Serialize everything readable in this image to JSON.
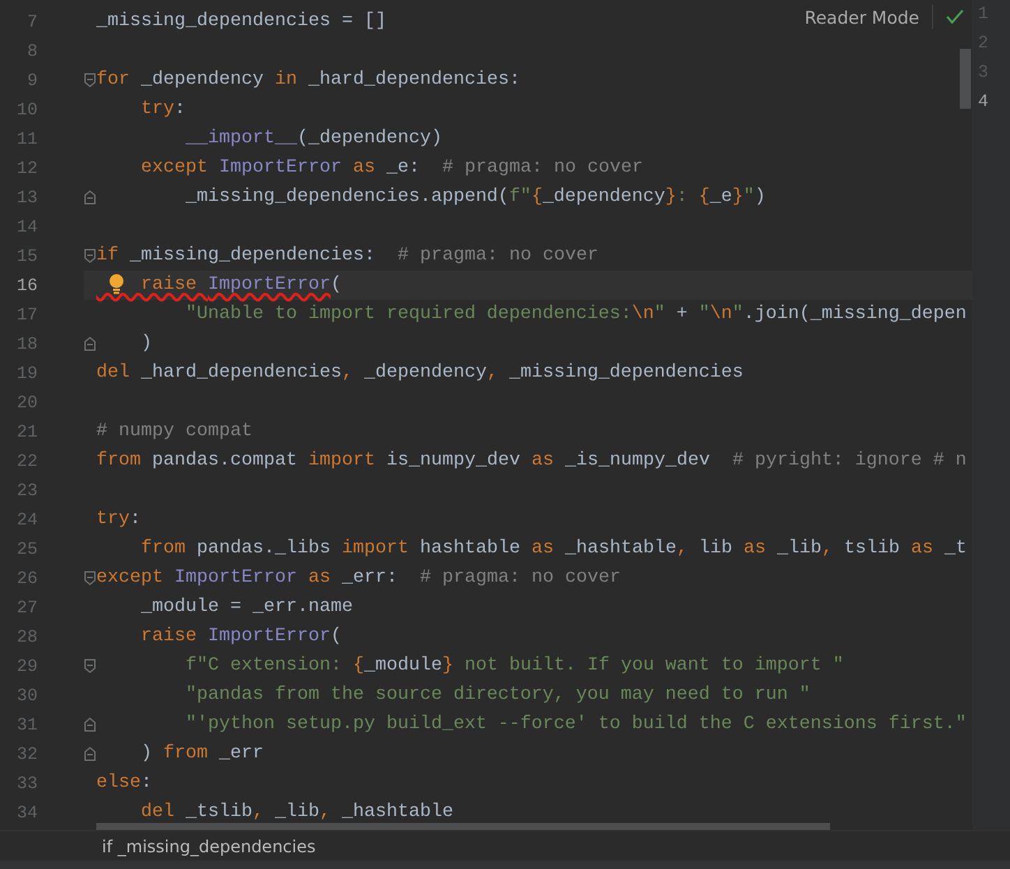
{
  "reader_mode": {
    "label": "Reader Mode"
  },
  "lines": [
    {
      "number": "7",
      "current": false,
      "bulb": false,
      "tokens": [
        {
          "kind": "plain",
          "text": "_missing_dependencies = []"
        }
      ]
    },
    {
      "number": "8",
      "current": false,
      "bulb": false
    },
    {
      "number": "9",
      "current": false,
      "bulb": false,
      "fold": {
        "kind": "start"
      },
      "tokens": [
        {
          "kind": "keyword",
          "text": "for"
        },
        {
          "kind": "plain",
          "text": " _dependency "
        },
        {
          "kind": "keyword",
          "text": "in"
        },
        {
          "kind": "plain",
          "text": " _hard_dependencies:"
        }
      ]
    },
    {
      "number": "10",
      "current": false,
      "bulb": false,
      "tokens": [
        {
          "kind": "keyword",
          "text": "    try"
        },
        {
          "kind": "plain",
          "text": ":"
        }
      ]
    },
    {
      "number": "11",
      "current": false,
      "bulb": false,
      "tokens": [
        {
          "kind": "builtin",
          "text": "        __import__"
        },
        {
          "kind": "plain",
          "text": "(_dependency)"
        }
      ]
    },
    {
      "number": "12",
      "current": false,
      "bulb": false,
      "tokens": [
        {
          "kind": "keyword",
          "text": "    except "
        },
        {
          "kind": "builtin",
          "text": "ImportError "
        },
        {
          "kind": "keyword",
          "text": "as"
        },
        {
          "kind": "plain",
          "text": " _e:  "
        },
        {
          "kind": "comment",
          "text": "# pragma: no cover"
        }
      ]
    },
    {
      "number": "13",
      "current": false,
      "bulb": false,
      "fold": {
        "kind": "end"
      },
      "tokens": [
        {
          "kind": "plain",
          "text": "        _missing_dependencies.append("
        },
        {
          "kind": "string",
          "text": "f\""
        },
        {
          "kind": "punct",
          "text": "{"
        },
        {
          "kind": "plain",
          "text": "_dependency"
        },
        {
          "kind": "punct",
          "text": "}"
        },
        {
          "kind": "string",
          "text": ": "
        },
        {
          "kind": "punct",
          "text": "{"
        },
        {
          "kind": "plain",
          "text": "_e"
        },
        {
          "kind": "punct",
          "text": "}"
        },
        {
          "kind": "string",
          "text": "\""
        },
        {
          "kind": "plain",
          "text": ")"
        }
      ]
    },
    {
      "number": "14",
      "current": false,
      "bulb": false
    },
    {
      "number": "15",
      "current": false,
      "bulb": false,
      "fold": {
        "kind": "start"
      },
      "tokens": [
        {
          "kind": "keyword",
          "text": "if"
        },
        {
          "kind": "plain",
          "text": " _missing_dependencies:  "
        },
        {
          "kind": "comment",
          "text": "# pragma: no cover"
        }
      ]
    },
    {
      "number": "16",
      "current": true,
      "bulb": true,
      "tokens": [
        {
          "kind": "keyword",
          "text": "    raise ",
          "error": true
        },
        {
          "kind": "builtin",
          "text": "ImportError",
          "error": true
        },
        {
          "kind": "plain",
          "text": "("
        }
      ]
    },
    {
      "number": "17",
      "current": false,
      "bulb": false,
      "tokens": [
        {
          "kind": "string",
          "text": "        \"Unable to import required dependencies:"
        },
        {
          "kind": "escape",
          "text": "\\n"
        },
        {
          "kind": "string",
          "text": "\""
        },
        {
          "kind": "plain",
          "text": " + "
        },
        {
          "kind": "string",
          "text": "\""
        },
        {
          "kind": "escape",
          "text": "\\n"
        },
        {
          "kind": "string",
          "text": "\""
        },
        {
          "kind": "plain",
          "text": ".join(_missing_depen"
        }
      ]
    },
    {
      "number": "18",
      "current": false,
      "bulb": false,
      "fold": {
        "kind": "end"
      },
      "tokens": [
        {
          "kind": "plain",
          "text": "    )"
        }
      ]
    },
    {
      "number": "19",
      "current": false,
      "bulb": false,
      "tokens": [
        {
          "kind": "keyword",
          "text": "del"
        },
        {
          "kind": "plain",
          "text": " _hard_dependencies"
        },
        {
          "kind": "punct",
          "text": ", "
        },
        {
          "kind": "plain",
          "text": "_dependency"
        },
        {
          "kind": "punct",
          "text": ", "
        },
        {
          "kind": "plain",
          "text": "_missing_dependencies"
        }
      ]
    },
    {
      "number": "20",
      "current": false,
      "bulb": false
    },
    {
      "number": "21",
      "current": false,
      "bulb": false,
      "tokens": [
        {
          "kind": "comment",
          "text": "# numpy compat"
        }
      ]
    },
    {
      "number": "22",
      "current": false,
      "bulb": false,
      "tokens": [
        {
          "kind": "keyword",
          "text": "from"
        },
        {
          "kind": "plain",
          "text": " pandas.compat "
        },
        {
          "kind": "keyword",
          "text": "import"
        },
        {
          "kind": "plain",
          "text": " is_numpy_dev "
        },
        {
          "kind": "keyword",
          "text": "as"
        },
        {
          "kind": "plain",
          "text": " _is_numpy_dev  "
        },
        {
          "kind": "comment",
          "text": "# pyright: ignore # n"
        }
      ]
    },
    {
      "number": "23",
      "current": false,
      "bulb": false
    },
    {
      "number": "24",
      "current": false,
      "bulb": false,
      "tokens": [
        {
          "kind": "keyword",
          "text": "try"
        },
        {
          "kind": "plain",
          "text": ":"
        }
      ]
    },
    {
      "number": "25",
      "current": false,
      "bulb": false,
      "tokens": [
        {
          "kind": "keyword",
          "text": "    from"
        },
        {
          "kind": "plain",
          "text": " pandas._libs "
        },
        {
          "kind": "keyword",
          "text": "import"
        },
        {
          "kind": "plain",
          "text": " hashtable "
        },
        {
          "kind": "keyword",
          "text": "as"
        },
        {
          "kind": "plain",
          "text": " _hashtable"
        },
        {
          "kind": "punct",
          "text": ", "
        },
        {
          "kind": "plain",
          "text": "lib "
        },
        {
          "kind": "keyword",
          "text": "as"
        },
        {
          "kind": "plain",
          "text": " _lib"
        },
        {
          "kind": "punct",
          "text": ", "
        },
        {
          "kind": "plain",
          "text": "tslib "
        },
        {
          "kind": "keyword",
          "text": "as"
        },
        {
          "kind": "plain",
          "text": " _t"
        }
      ]
    },
    {
      "number": "26",
      "current": false,
      "bulb": false,
      "fold": {
        "kind": "start"
      },
      "tokens": [
        {
          "kind": "keyword",
          "text": "except "
        },
        {
          "kind": "builtin",
          "text": "ImportError "
        },
        {
          "kind": "keyword",
          "text": "as"
        },
        {
          "kind": "plain",
          "text": " _err:  "
        },
        {
          "kind": "comment",
          "text": "# pragma: no cover"
        }
      ]
    },
    {
      "number": "27",
      "current": false,
      "bulb": false,
      "tokens": [
        {
          "kind": "plain",
          "text": "    _module = _err.name"
        }
      ]
    },
    {
      "number": "28",
      "current": false,
      "bulb": false,
      "tokens": [
        {
          "kind": "keyword",
          "text": "    raise "
        },
        {
          "kind": "builtin",
          "text": "ImportError"
        },
        {
          "kind": "plain",
          "text": "("
        }
      ]
    },
    {
      "number": "29",
      "current": false,
      "bulb": false,
      "fold": {
        "kind": "start"
      },
      "tokens": [
        {
          "kind": "string",
          "text": "        f\"C extension: "
        },
        {
          "kind": "punct",
          "text": "{"
        },
        {
          "kind": "plain",
          "text": "_module"
        },
        {
          "kind": "punct",
          "text": "}"
        },
        {
          "kind": "string",
          "text": " not built. If you want to import \""
        }
      ]
    },
    {
      "number": "30",
      "current": false,
      "bulb": false,
      "tokens": [
        {
          "kind": "string",
          "text": "        \"pandas from the source directory, you may need to run \""
        }
      ]
    },
    {
      "number": "31",
      "current": false,
      "bulb": false,
      "fold": {
        "kind": "end"
      },
      "tokens": [
        {
          "kind": "string",
          "text": "        \"'python setup.py build_ext --force' to build the C extensions first.\""
        }
      ]
    },
    {
      "number": "32",
      "current": false,
      "bulb": false,
      "fold": {
        "kind": "end"
      },
      "tokens": [
        {
          "kind": "plain",
          "text": "    ) "
        },
        {
          "kind": "keyword",
          "text": "from"
        },
        {
          "kind": "plain",
          "text": " _err"
        }
      ]
    },
    {
      "number": "33",
      "current": false,
      "bulb": false,
      "tokens": [
        {
          "kind": "keyword",
          "text": "else"
        },
        {
          "kind": "plain",
          "text": ":"
        }
      ]
    },
    {
      "number": "34",
      "current": false,
      "bulb": false,
      "tokens": [
        {
          "kind": "keyword",
          "text": "    del"
        },
        {
          "kind": "plain",
          "text": " _tslib"
        },
        {
          "kind": "punct",
          "text": ", "
        },
        {
          "kind": "plain",
          "text": "_lib"
        },
        {
          "kind": "punct",
          "text": ", "
        },
        {
          "kind": "plain",
          "text": "_hashtable"
        }
      ]
    }
  ],
  "side_gutter": [
    {
      "number": "1",
      "current": false
    },
    {
      "number": "2",
      "current": false
    },
    {
      "number": "3",
      "current": false
    },
    {
      "number": "4",
      "current": true
    }
  ],
  "breadcrumb": "if _missing_dependencies"
}
